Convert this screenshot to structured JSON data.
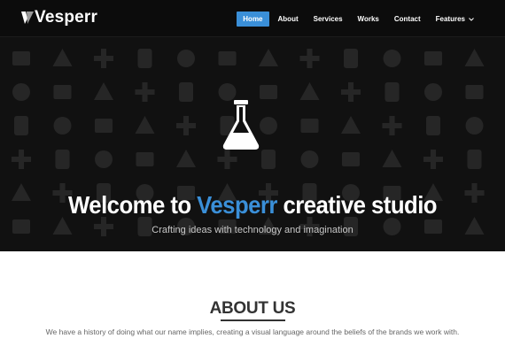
{
  "brand": {
    "name": "Vesperr",
    "accent_color": "#3a8fd8"
  },
  "nav": {
    "items": [
      {
        "label": "Home",
        "active": true
      },
      {
        "label": "About",
        "active": false
      },
      {
        "label": "Services",
        "active": false
      },
      {
        "label": "Works",
        "active": false
      },
      {
        "label": "Contact",
        "active": false
      },
      {
        "label": "Features",
        "active": false,
        "dropdown": true
      }
    ]
  },
  "hero": {
    "icon": "flask-icon",
    "title_prefix": "Welcome to ",
    "title_accent": "Vesperr",
    "title_suffix": " creative studio",
    "subtitle": "Crafting ideas with technology and imagination",
    "background_icons": [
      "gear-icon",
      "gear-icon",
      "facebook-icon",
      "gamepad-icon",
      "camera-icon",
      "cloud-upload-icon",
      "cloud-download-icon",
      "cloud-icon",
      "unlock-icon",
      "unlock-icon",
      "lock-icon",
      "pill-icon",
      "pill-icon",
      "mailbox-icon",
      "facebook-icon",
      "share-icon",
      "twitter-icon",
      "dribbble-icon",
      "instagram-icon",
      "instagram-icon",
      "film-icon",
      "film-icon",
      "tv-icon",
      "browser-icon",
      "bag-icon",
      "bag-icon",
      "basket-icon",
      "tag-icon",
      "tag-icon",
      "ticket-icon",
      "ticket-icon",
      "play-icon",
      "volume-icon",
      "dropper-icon",
      "dropper-icon",
      "cocktail-icon",
      "cocktail-icon",
      "monitor-icon",
      "icecream-icon",
      "icecream-icon",
      "check-icon",
      "close-icon",
      "plus-icon",
      "minus-icon",
      "star-icon",
      "arrow-up-icon",
      "arrow-down-icon",
      "monitor-icon"
    ]
  },
  "about": {
    "title": "ABOUT US",
    "text": "We have a history of doing what our name implies, creating a visual language around the beliefs of the brands we work with."
  }
}
